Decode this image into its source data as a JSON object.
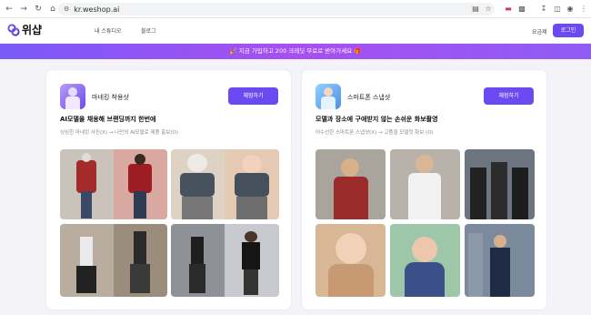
{
  "browser": {
    "url": "kr.weshop.ai",
    "nav_icons": [
      "back-icon",
      "forward-icon",
      "reload-icon",
      "home-icon"
    ],
    "toolbar_icons": [
      "translate-icon",
      "star-icon",
      "extension-icon",
      "puzzle-icon",
      "download-icon",
      "sidepanel-icon",
      "profile-icon",
      "menu-icon"
    ]
  },
  "header": {
    "logo_text": "위샵",
    "nav_items": [
      "내 스튜디오",
      "블로그"
    ],
    "pricing_label": "요금제",
    "login_label": "로그인"
  },
  "banner": {
    "text": "🎉 지금 가입하고 200 크레딧 무료로 받아가세요 🎁"
  },
  "cards": [
    {
      "title": "마네킹 착용샷",
      "button": "체험하기",
      "headline": "AI모델을 채용해 브랜딩까지 한번에",
      "subtext": "심심한 마네킹 사진(X) → 나만의 AI모델로 제품 홍보(O)"
    },
    {
      "title": "스마트폰 스냅샷",
      "button": "체험하기",
      "headline": "모델과 장소에 구애받지 않는 손쉬운 화보촬영",
      "subtext": "어수선한 스마트폰 스냅샷(X) → 고품질 모델컷 화보 (O)"
    }
  ],
  "colors": {
    "accent": "#6c4af2",
    "banner_start": "#7a5af8",
    "banner_end": "#a74ff2"
  }
}
